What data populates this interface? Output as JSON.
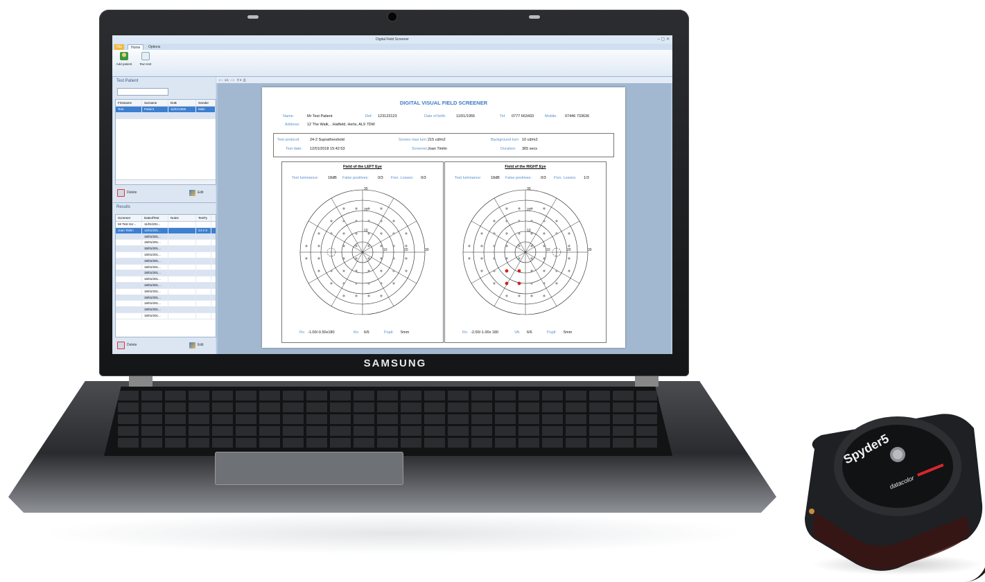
{
  "device": {
    "laptop_brand": "SAMSUNG",
    "calibrator_brand": "Spyder5",
    "calibrator_maker": "datacolor"
  },
  "app": {
    "title": "Digital Field Screener",
    "tabs": [
      {
        "label": "File"
      },
      {
        "label": "Home"
      },
      {
        "label": "Options"
      }
    ],
    "ribbon": {
      "buttons": [
        {
          "label": "Add patient",
          "icon": "add-patient-icon"
        },
        {
          "label": "Run test",
          "icon": "run-test-icon"
        }
      ]
    },
    "patients": {
      "section_title": "Test Patient",
      "search_value": "",
      "columns": [
        "Firstname",
        "Surname",
        "DoB",
        "Gender"
      ],
      "rows": [
        [
          "Test",
          "Patient",
          "11/01/1955",
          "Male"
        ]
      ],
      "delete_label": "Delete",
      "edit_label": "Edit"
    },
    "results": {
      "section_title": "Results",
      "columns": [
        "Screener",
        "DateofTest",
        "Notes",
        "TestTy"
      ],
      "rows": [
        [
          "Mr Test Scr...",
          "11/01/201...",
          "",
          ""
        ],
        [
          "Joan Timlin",
          "12/01/201...",
          "",
          "24-2 S"
        ],
        [
          "",
          "15/01/201...",
          "",
          ""
        ],
        [
          "",
          "15/01/201...",
          "",
          ""
        ],
        [
          "",
          "15/01/201...",
          "",
          ""
        ],
        [
          "",
          "15/01/201...",
          "",
          ""
        ],
        [
          "",
          "15/01/201...",
          "",
          ""
        ],
        [
          "",
          "15/01/201...",
          "",
          ""
        ],
        [
          "",
          "15/01/201...",
          "",
          ""
        ],
        [
          "",
          "15/01/201...",
          "",
          ""
        ],
        [
          "",
          "15/01/201...",
          "",
          ""
        ],
        [
          "",
          "15/01/201...",
          "",
          ""
        ],
        [
          "",
          "15/01/201...",
          "",
          ""
        ],
        [
          "",
          "15/01/201...",
          "",
          ""
        ],
        [
          "",
          "15/01/201...",
          "",
          ""
        ],
        [
          "",
          "15/01/201...",
          "",
          ""
        ]
      ],
      "delete_label": "Delete",
      "edit_label": "Edit"
    },
    "viewer": {
      "page_indicator": "1/1"
    }
  },
  "report": {
    "title": "DIGITAL VISUAL FIELD SCREENER",
    "patient": {
      "name_label": "Name:",
      "name": "Mr Test Patient",
      "ref_label": "Ref:",
      "ref": "123123123",
      "dob_label": "Date of birth:",
      "dob": "11/01/1955",
      "tel_label": "Tel:",
      "tel": "0777 663433",
      "mobile_label": "Mobile:",
      "mobile": "07446 733636",
      "address_label": "Address:",
      "address": "12 The Walk, , Hatfield, Herts, AL9 7DW"
    },
    "test": {
      "protocol_label": "Test protocol:",
      "protocol": "24-2 Suprathreshold",
      "screen_lum_label": "Screen max lum:",
      "screen_lum": "215 cd/m2",
      "bg_lum_label": "Background lum:",
      "bg_lum": "10 cd/m2",
      "date_label": "Test date:",
      "date": "12/01/2018 15:42:53",
      "screener_label": "Screener:",
      "screener": "Joan Timlin",
      "duration_label": "Duration:",
      "duration": "365 secs"
    },
    "left_eye": {
      "title": "Field of the LEFT Eye",
      "lum_label": "Test luminance:",
      "lum": "18dB",
      "fp_label": "False positives:",
      "fp": "0/3",
      "fl_label": "Fixn. Losses:",
      "fl": "0/3",
      "rx_label": "Rx:",
      "rx": "-1.00/-0.50x180",
      "va_label": "Rx:",
      "va": "6/6",
      "pupil_label": "Pupil:",
      "pupil": "5mm",
      "ring_labels": [
        "30",
        "20",
        "10",
        "10",
        "20",
        "30"
      ],
      "blind_spot": "left",
      "defects": []
    },
    "right_eye": {
      "title": "Field of the RIGHT Eye",
      "lum_label": "Test luminance:",
      "lum": "18dB",
      "fp_label": "False positives:",
      "fp": "0/3",
      "fl_label": "Fixn. Losses:",
      "fl": "1/3",
      "rx_label": "Rx:",
      "rx": "-2.00/-1.00x 180",
      "va_label": "VA:",
      "va": "6/6",
      "pupil_label": "Pupil:",
      "pupil": "5mm",
      "ring_labels": [
        "30",
        "20",
        "10",
        "10",
        "20",
        "30"
      ],
      "blind_spot": "right",
      "defects": [
        [
          -3,
          -3
        ],
        [
          -1,
          -3
        ],
        [
          -3,
          -5
        ],
        [
          -1,
          -5
        ]
      ]
    },
    "colors": {
      "label": "#5b8ecb",
      "defect": "#d42020",
      "seen": "#9a9a9a"
    }
  }
}
